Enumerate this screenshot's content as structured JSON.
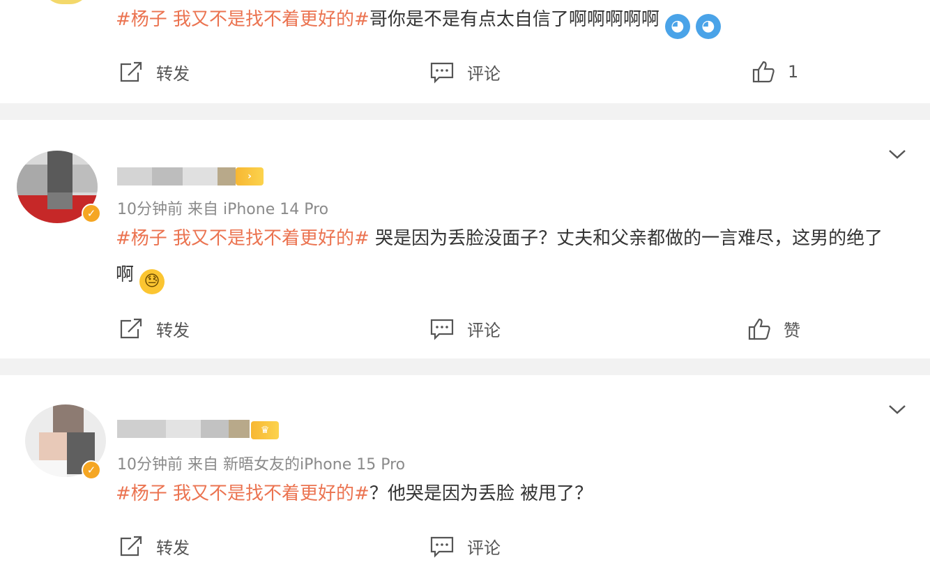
{
  "cards": [
    {
      "content": {
        "topic": "#杨子 我又不是找不着更好的#",
        "text": "哥你是不是有点太自信了啊啊啊啊啊"
      },
      "actions": {
        "repost": "转发",
        "comment": "评论",
        "like": "1"
      }
    },
    {
      "meta": "10分钟前 来自 iPhone 14 Pro",
      "content": {
        "topic": "#杨子 我又不是找不着更好的#",
        "text": " 哭是因为丢脸没面子？丈夫和父亲都做的一言难尽，这男的绝了啊"
      },
      "actions": {
        "repost": "转发",
        "comment": "评论",
        "like": "赞"
      }
    },
    {
      "meta": "10分钟前 来自 新晤女友的iPhone 15 Pro",
      "content": {
        "topic": "#杨子 我又不是找不着更好的#",
        "text": "？他哭是因为丢脸 被甩了？"
      },
      "actions": {
        "repost": "转发",
        "comment": "评论"
      }
    }
  ],
  "icons": {
    "repost": "repost-icon",
    "comment": "comment-icon",
    "like": "thumbs-up-icon",
    "more": "chevron-down-icon",
    "verified": "verified-badge-icon",
    "emoji_doraemon": "doraemon-emoji-icon",
    "emoji_sweat": "sweat-face-emoji-icon"
  },
  "colors": {
    "topic": "#eb7350",
    "verified": "#f5a623",
    "background": "#f2f2f2"
  }
}
